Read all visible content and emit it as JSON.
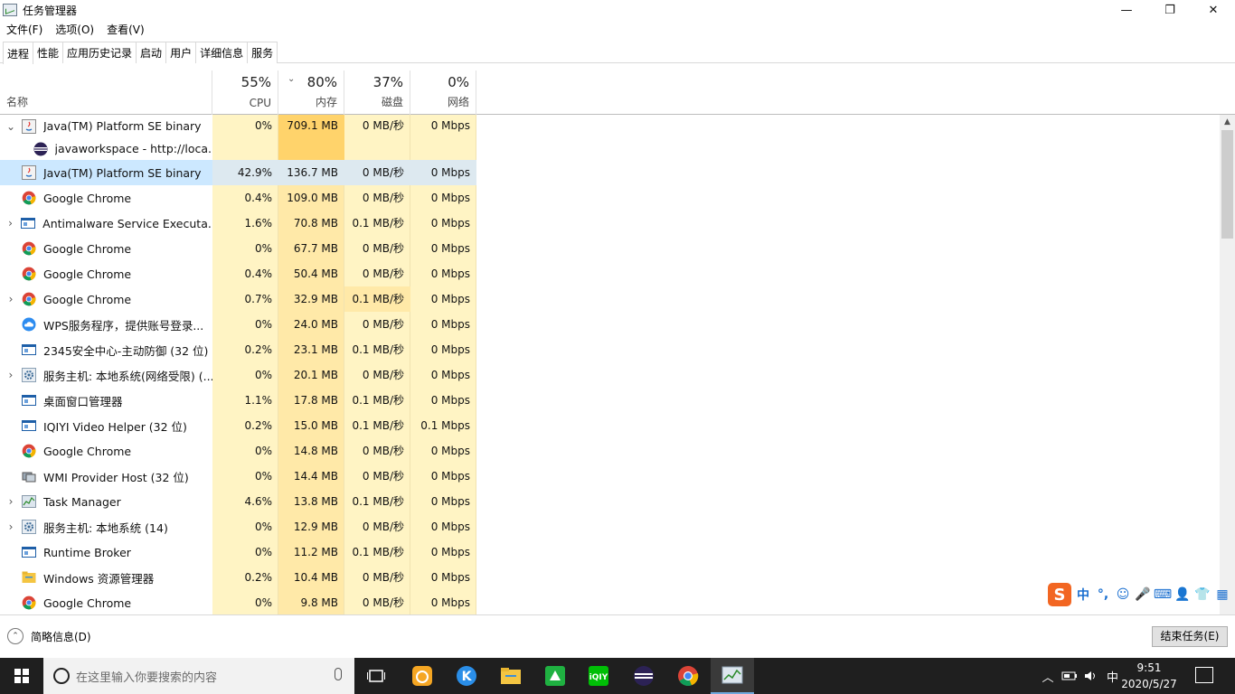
{
  "window": {
    "title": "任务管理器",
    "min": "—",
    "max": "❐",
    "close": "✕"
  },
  "menu": [
    "文件(F)",
    "选项(O)",
    "查看(V)"
  ],
  "tabs": [
    "进程",
    "性能",
    "应用历史记录",
    "启动",
    "用户",
    "详细信息",
    "服务"
  ],
  "header": {
    "name": "名称",
    "cpu": {
      "pct": "55%",
      "label": "CPU"
    },
    "mem": {
      "pct": "80%",
      "label": "内存"
    },
    "disk": {
      "pct": "37%",
      "label": "磁盘"
    },
    "net": {
      "pct": "0%",
      "label": "网络"
    }
  },
  "processes": [
    {
      "name": "Java(TM) Platform SE binary",
      "cpu": "0%",
      "mem": "709.1 MB",
      "disk": "0 MB/秒",
      "net": "0 Mbps",
      "exp": "open",
      "icon": "java-icon"
    },
    {
      "name": "javaworkspace - http://loca...",
      "cpu": "",
      "mem": "",
      "disk": "",
      "net": "",
      "exp": "child",
      "icon": "eclipse-icon"
    },
    {
      "name": "Java(TM) Platform SE binary",
      "cpu": "42.9%",
      "mem": "136.7 MB",
      "disk": "0 MB/秒",
      "net": "0 Mbps",
      "exp": "none",
      "icon": "java-icon"
    },
    {
      "name": "Google Chrome",
      "cpu": "0.4%",
      "mem": "109.0 MB",
      "disk": "0 MB/秒",
      "net": "0 Mbps",
      "exp": "none",
      "icon": "chrome-icon"
    },
    {
      "name": "Antimalware Service Executa...",
      "cpu": "1.6%",
      "mem": "70.8 MB",
      "disk": "0.1 MB/秒",
      "net": "0 Mbps",
      "exp": "closed",
      "icon": "window-icon"
    },
    {
      "name": "Google Chrome",
      "cpu": "0%",
      "mem": "67.7 MB",
      "disk": "0 MB/秒",
      "net": "0 Mbps",
      "exp": "none",
      "icon": "chrome-icon"
    },
    {
      "name": "Google Chrome",
      "cpu": "0.4%",
      "mem": "50.4 MB",
      "disk": "0 MB/秒",
      "net": "0 Mbps",
      "exp": "none",
      "icon": "chrome-icon"
    },
    {
      "name": "Google Chrome",
      "cpu": "0.7%",
      "mem": "32.9 MB",
      "disk": "0.1 MB/秒",
      "net": "0 Mbps",
      "exp": "closed",
      "icon": "chrome-icon"
    },
    {
      "name": "WPS服务程序，提供账号登录...",
      "cpu": "0%",
      "mem": "24.0 MB",
      "disk": "0 MB/秒",
      "net": "0 Mbps",
      "exp": "none",
      "icon": "cloud-icon"
    },
    {
      "name": "2345安全中心-主动防御 (32 位)",
      "cpu": "0.2%",
      "mem": "23.1 MB",
      "disk": "0.1 MB/秒",
      "net": "0 Mbps",
      "exp": "none",
      "icon": "window-icon"
    },
    {
      "name": "服务主机: 本地系统(网络受限) (...",
      "cpu": "0%",
      "mem": "20.1 MB",
      "disk": "0 MB/秒",
      "net": "0 Mbps",
      "exp": "closed",
      "icon": "gear-icon"
    },
    {
      "name": "桌面窗口管理器",
      "cpu": "1.1%",
      "mem": "17.8 MB",
      "disk": "0.1 MB/秒",
      "net": "0 Mbps",
      "exp": "none",
      "icon": "window-icon"
    },
    {
      "name": "IQIYI Video Helper (32 位)",
      "cpu": "0.2%",
      "mem": "15.0 MB",
      "disk": "0.1 MB/秒",
      "net": "0.1 Mbps",
      "exp": "none",
      "icon": "window-icon"
    },
    {
      "name": "Google Chrome",
      "cpu": "0%",
      "mem": "14.8 MB",
      "disk": "0 MB/秒",
      "net": "0 Mbps",
      "exp": "none",
      "icon": "chrome-icon"
    },
    {
      "name": "WMI Provider Host (32 位)",
      "cpu": "0%",
      "mem": "14.4 MB",
      "disk": "0 MB/秒",
      "net": "0 Mbps",
      "exp": "none",
      "icon": "wmi-icon"
    },
    {
      "name": "Task Manager",
      "cpu": "4.6%",
      "mem": "13.8 MB",
      "disk": "0.1 MB/秒",
      "net": "0 Mbps",
      "exp": "closed",
      "icon": "taskmgr-icon"
    },
    {
      "name": "服务主机: 本地系统 (14)",
      "cpu": "0%",
      "mem": "12.9 MB",
      "disk": "0 MB/秒",
      "net": "0 Mbps",
      "exp": "closed",
      "icon": "gear-icon"
    },
    {
      "name": "Runtime Broker",
      "cpu": "0%",
      "mem": "11.2 MB",
      "disk": "0.1 MB/秒",
      "net": "0 Mbps",
      "exp": "none",
      "icon": "window-icon"
    },
    {
      "name": "Windows 资源管理器",
      "cpu": "0.2%",
      "mem": "10.4 MB",
      "disk": "0 MB/秒",
      "net": "0 Mbps",
      "exp": "none",
      "icon": "folder-icon"
    },
    {
      "name": "Google Chrome",
      "cpu": "0%",
      "mem": "9.8 MB",
      "disk": "0 MB/秒",
      "net": "0 Mbps",
      "exp": "none",
      "icon": "chrome-icon"
    }
  ],
  "footer": {
    "fewer": "简略信息(D)",
    "end_task": "结束任务(E)"
  },
  "ime": {
    "logo": "S",
    "items": [
      "中",
      "°,",
      "☺",
      "🎤",
      "⌨",
      "👤",
      "👕",
      "▦"
    ]
  },
  "taskbar": {
    "search_placeholder": "在这里输入你要搜索的内容",
    "tray_lang": "中",
    "time": "9:51",
    "date": "2020/5/27"
  },
  "colors": {
    "cpu_bg": "#fff4c4",
    "mem_bg": "#ffe9a8",
    "mem_hot": "#ffd36b",
    "disk_bg": "#fff4c4",
    "disk_hot": "#ffe9a8",
    "net_bg": "#fff4c4",
    "selected": "#cce8ff",
    "selected_cols": "#dde9f0"
  }
}
